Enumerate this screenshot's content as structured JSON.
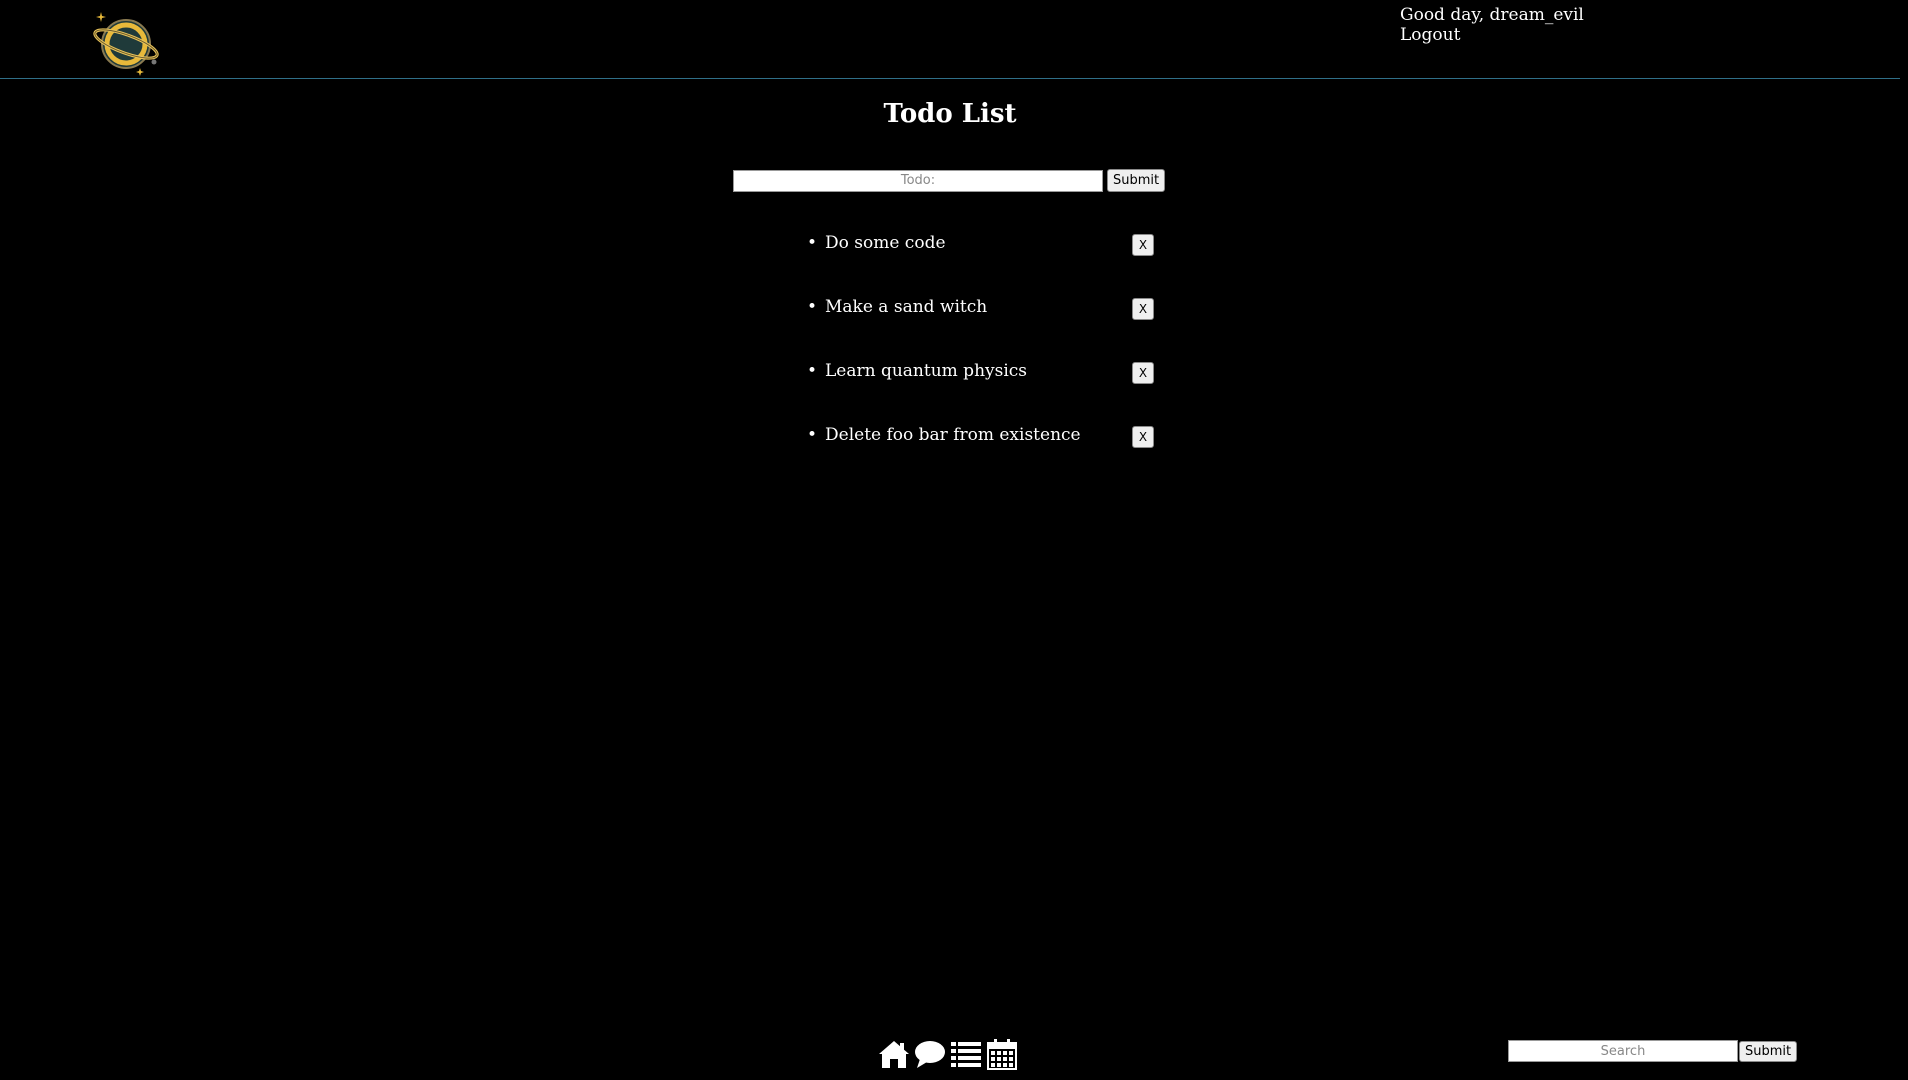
{
  "header": {
    "greeting": "Good day, dream_evil",
    "logout_label": "Logout",
    "logo_icon": "planet-logo-icon"
  },
  "main": {
    "title": "Todo List",
    "form": {
      "placeholder": "Todo:",
      "value": "",
      "submit_label": "Submit"
    },
    "todos": [
      {
        "text": "Do some code",
        "delete_label": "X"
      },
      {
        "text": "Make a sand witch",
        "delete_label": "X"
      },
      {
        "text": "Learn quantum physics",
        "delete_label": "X"
      },
      {
        "text": "Delete foo bar from existence",
        "delete_label": "X"
      }
    ]
  },
  "footer": {
    "nav_icons": [
      "home-icon",
      "chat-bubble-icon",
      "list-icon",
      "calendar-icon"
    ],
    "search": {
      "placeholder": "Search",
      "value": "",
      "submit_label": "Submit"
    }
  },
  "colors": {
    "background": "#000000",
    "text": "#ffffff",
    "header_border": "#2f6f88",
    "logo_gold": "#e8b93a",
    "logo_dark": "#1f3a3a"
  }
}
